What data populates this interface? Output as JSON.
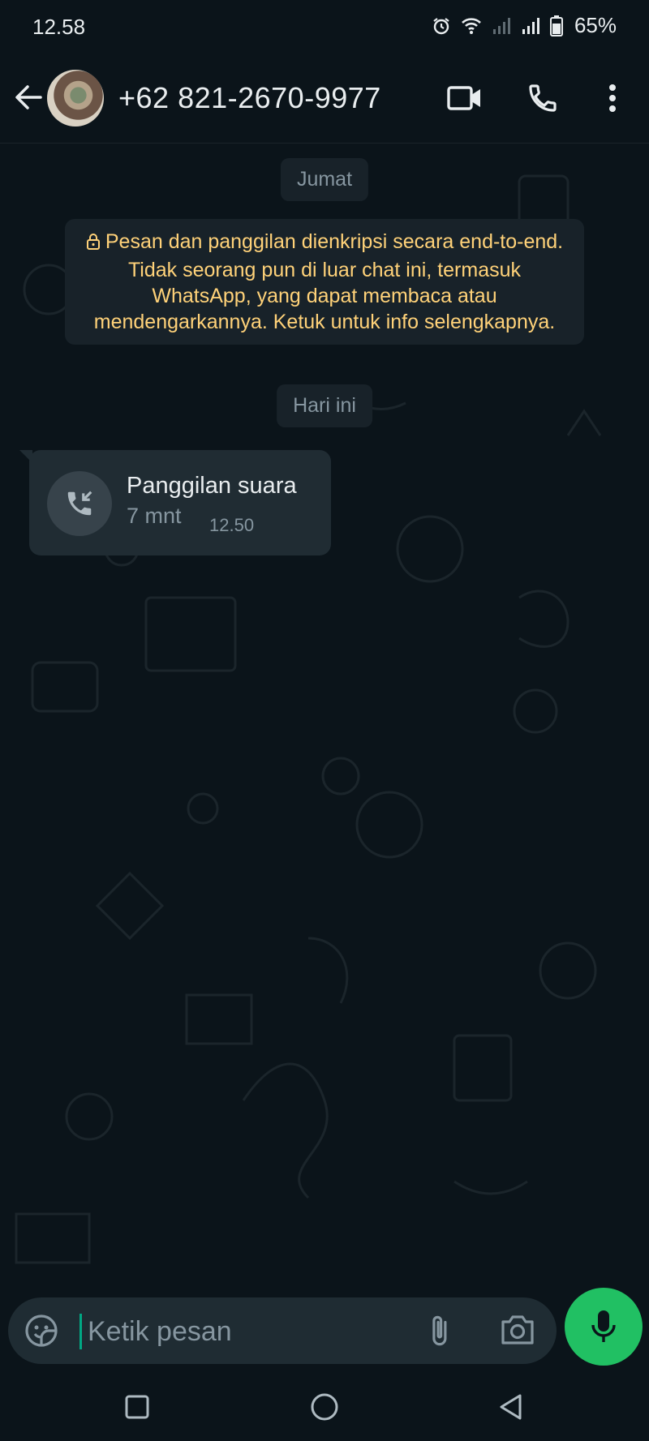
{
  "status_bar": {
    "time": "12.58",
    "battery": "65%"
  },
  "header": {
    "contact": "+62 821-2670-9977"
  },
  "chat": {
    "date_chip_1": "Jumat",
    "encryption_notice": "Pesan dan panggilan dienkripsi secara end-to-end. Tidak seorang pun di luar chat ini, termasuk WhatsApp, yang dapat membaca atau mendengarkannya. Ketuk untuk info selengkapnya.",
    "date_chip_2": "Hari ini",
    "call_message": {
      "title": "Panggilan suara",
      "duration": "7 mnt",
      "time": "12.50"
    }
  },
  "input": {
    "placeholder": "Ketik pesan"
  },
  "colors": {
    "background": "#0b141a",
    "bubble": "#202c33",
    "accent_green": "#21c063",
    "encryption_text": "#ffd279"
  }
}
